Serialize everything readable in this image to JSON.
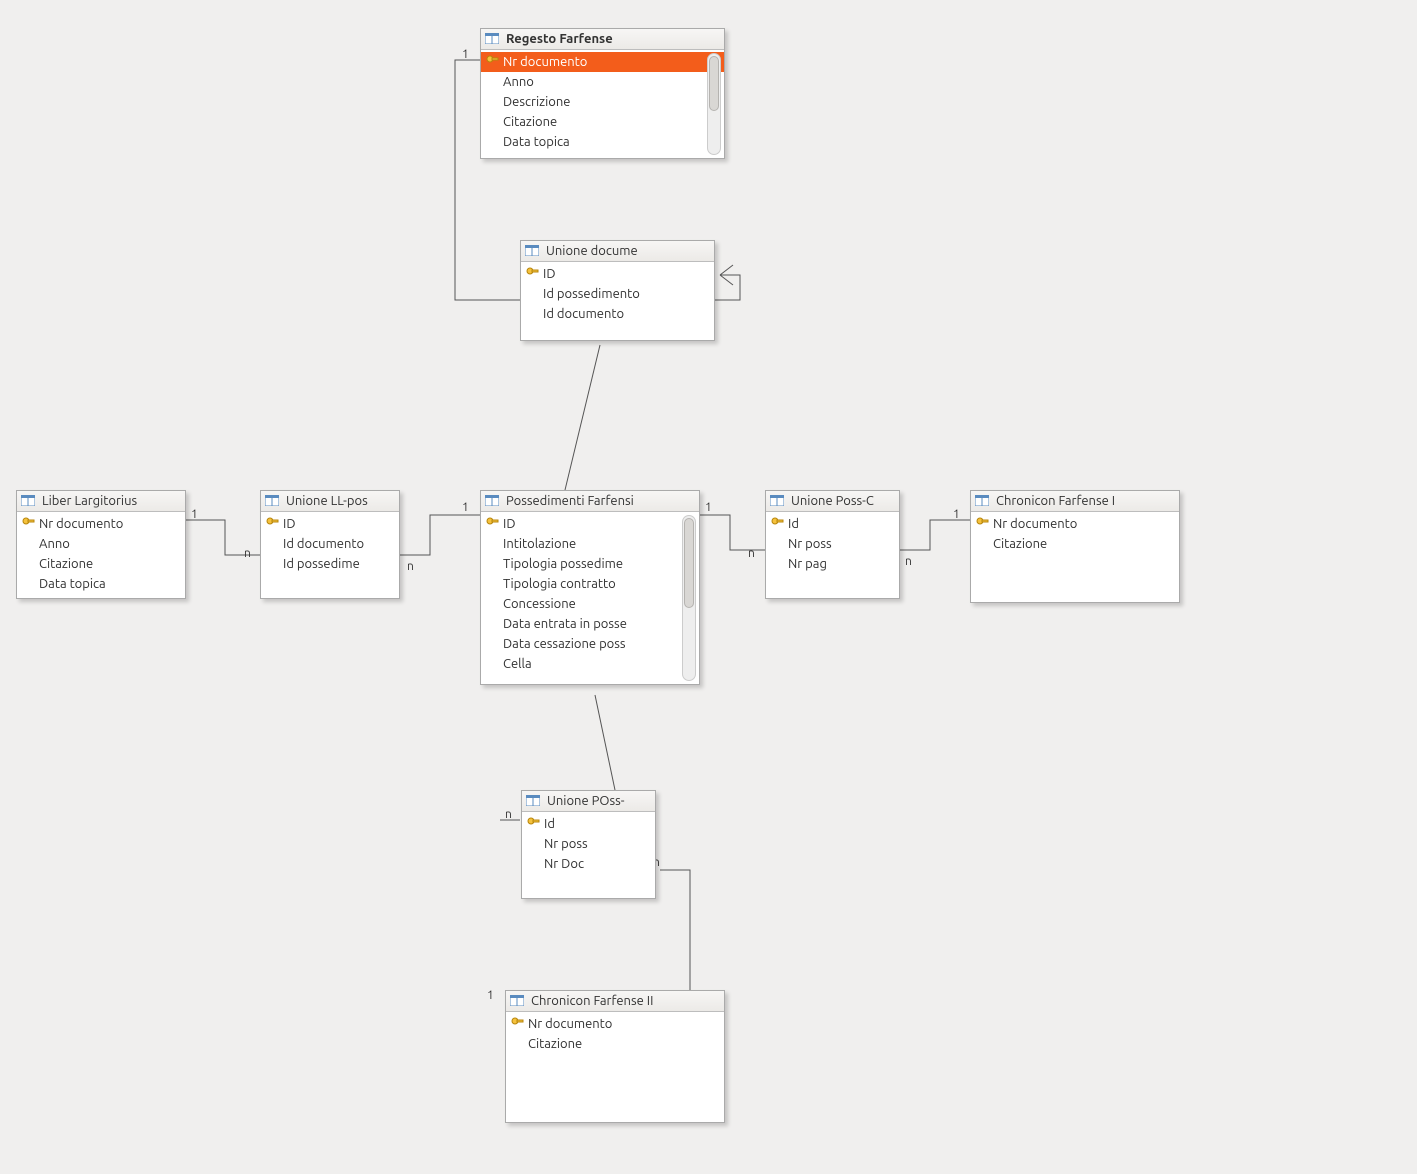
{
  "tables": {
    "regesto": {
      "title": "Regesto Farfense",
      "fields": [
        "Nr documento",
        "Anno",
        "Descrizione",
        "Citazione",
        "Data topica"
      ]
    },
    "unione_docume": {
      "title": "Unione docume",
      "fields": [
        "ID",
        "Id possedimento",
        "Id documento"
      ]
    },
    "liber": {
      "title": "Liber Largitorius",
      "fields": [
        "Nr documento",
        "Anno",
        "Citazione",
        "Data topica"
      ]
    },
    "unione_ll": {
      "title": "Unione LL-pos",
      "fields": [
        "ID",
        "Id documento",
        "Id possedime"
      ]
    },
    "possedimenti": {
      "title": "Possedimenti Farfensi",
      "fields": [
        "ID",
        "Intitolazione",
        "Tipologia possedime",
        "Tipologia contratto",
        "Concessione",
        "Data entrata in posse",
        "Data cessazione poss",
        "Cella"
      ]
    },
    "unione_poss_c": {
      "title": "Unione Poss-C",
      "fields": [
        "Id",
        "Nr poss",
        "Nr pag"
      ]
    },
    "chronicon1": {
      "title": "Chronicon Farfense I",
      "fields": [
        "Nr documento",
        "Citazione"
      ]
    },
    "unione_poss_d": {
      "title": "Unione POss-",
      "fields": [
        "Id",
        "Nr  poss",
        "Nr Doc"
      ]
    },
    "chronicon2": {
      "title": "Chronicon Farfense II",
      "fields": [
        "Nr documento",
        "Citazione"
      ]
    }
  },
  "cardinality": {
    "one": "1",
    "many": "n"
  }
}
